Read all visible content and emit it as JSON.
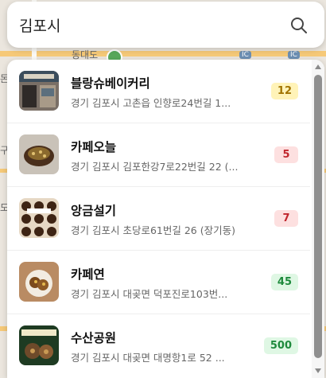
{
  "search": {
    "value": "김포시",
    "icon": "search-icon"
  },
  "map": {
    "labels": [
      "동대도",
      "IC",
      "IC",
      "돈",
      "도",
      "구"
    ]
  },
  "results": [
    {
      "name": "블랑슈베이커리",
      "address": "경기 김포시 고촌읍 인향로24번길 1...",
      "count": "12",
      "badge_bg": "#fff3b8",
      "badge_fg": "#a17300"
    },
    {
      "name": "카페오늘",
      "address": "경기 김포시 김포한강7로22번길 22 (...",
      "count": "5",
      "badge_bg": "#fde0e0",
      "badge_fg": "#c0262d"
    },
    {
      "name": "앙금설기",
      "address": "경기 김포시 초당로61번길 26 (장기동)",
      "count": "7",
      "badge_bg": "#fde0e0",
      "badge_fg": "#c0262d"
    },
    {
      "name": "카페연",
      "address": "경기 김포시 대곶면 덕포진로103번...",
      "count": "45",
      "badge_bg": "#dff7e4",
      "badge_fg": "#1e8a3c"
    },
    {
      "name": "수산공원",
      "address": "경기 김포시 대곶면 대명항1로 52 ...",
      "count": "500",
      "badge_bg": "#dff7e4",
      "badge_fg": "#1e8a3c"
    }
  ]
}
